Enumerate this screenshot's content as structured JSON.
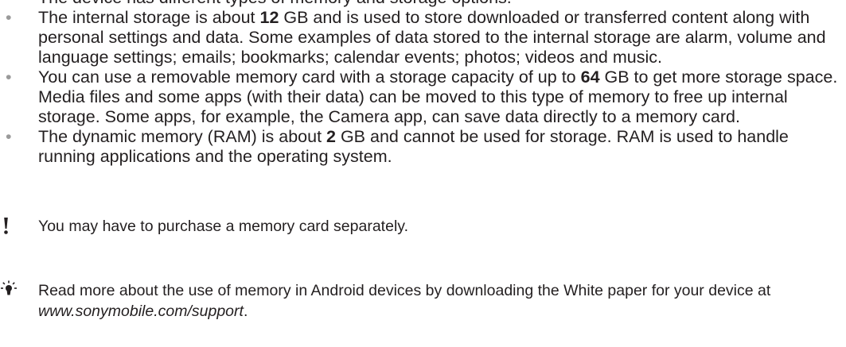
{
  "cut_line": "The device has different types of memory and storage options.",
  "bullets": [
    {
      "before": "The internal storage is about ",
      "number": "12",
      "after": " GB and is used to store downloaded or transferred content along with personal settings and data. Some examples of data stored to the internal storage are alarm, volume and language settings; emails; bookmarks; calendar events; photos; videos and music."
    },
    {
      "before": "You can use a removable memory card with a storage capacity of up to ",
      "number": "64",
      "after": " GB to get more storage space. Media files and some apps (with their data) can be moved to this type of memory to free up internal storage. Some apps, for example, the Camera app, can save data directly to a memory card."
    },
    {
      "before": "The dynamic memory (RAM) is about ",
      "number": "2",
      "after": " GB and cannot be used for storage. RAM is used to handle running applications and the operating system."
    }
  ],
  "bullet_symbol": "•",
  "warning_note": {
    "icon": "exclamation-icon",
    "text": "You may have to purchase a memory card separately."
  },
  "tip_note": {
    "icon": "lightbulb-icon",
    "text_before": "Read more about the use of memory in Android devices by downloading the White paper for your device at ",
    "url": "www.sonymobile.com/support",
    "text_after": "."
  }
}
